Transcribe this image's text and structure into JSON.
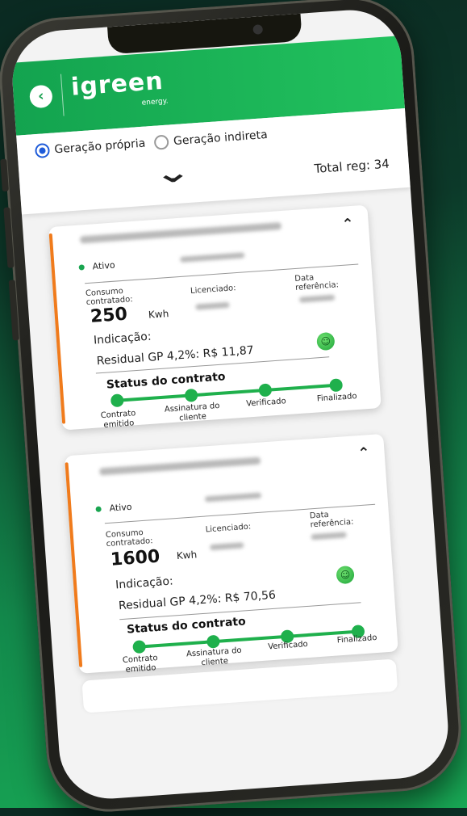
{
  "header": {
    "back_icon": "chevron-left-icon",
    "brand_name": "igreen",
    "brand_sub": "energy."
  },
  "filter": {
    "option1": "Geração própria",
    "option2": "Geração indireta",
    "selected": "Geração própria",
    "expand_icon": "chevron-down-icon",
    "total_label": "Total reg: 34"
  },
  "cards": [
    {
      "status": "Ativo",
      "consumo_label": "Consumo contratado:",
      "consumo_value": "250",
      "unit": "Kwh",
      "licenciado_label": "Licenciado:",
      "data_ref_label": "Data referência:",
      "indicacao_label": "Indicação:",
      "residual": "Residual GP 4,2%: R$ 11,87",
      "status_title": "Status do contrato",
      "steps": [
        "Contrato emitido",
        "Assinatura do cliente",
        "Verificado",
        "Finalizado"
      ]
    },
    {
      "status": "Ativo",
      "consumo_label": "Consumo contratado:",
      "consumo_value": "1600",
      "unit": "Kwh",
      "licenciado_label": "Licenciado:",
      "data_ref_label": "Data referência:",
      "indicacao_label": "Indicação:",
      "residual": "Residual GP 4,2%: R$ 70,56",
      "status_title": "Status do contrato",
      "steps": [
        "Contrato emitido",
        "Assinatura do cliente",
        "Verificado",
        "Finalizado"
      ]
    }
  ],
  "colors": {
    "brand_green": "#1fb04c",
    "accent_orange": "#f07b1c",
    "radio_blue": "#1e5bd9"
  }
}
